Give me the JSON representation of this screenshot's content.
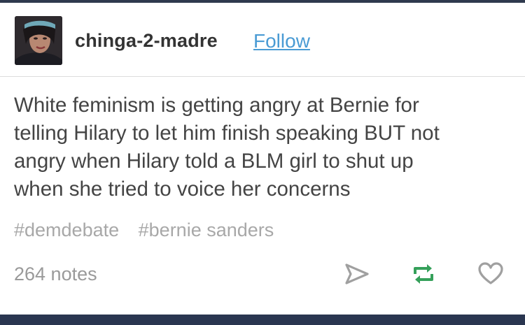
{
  "post": {
    "username": "chinga-2-madre",
    "follow_label": "Follow",
    "body_lines": [
      "White feminism is getting angry at Bernie for",
      "telling Hilary to let him finish speaking BUT not",
      "angry when Hilary told a BLM girl to shut up",
      "when she tried to voice her concerns"
    ],
    "tags": [
      "#demdebate",
      "#bernie sanders"
    ],
    "notes": "264 notes"
  },
  "icons": {
    "share": "paper-plane-icon",
    "reblog": "reblog-icon",
    "like": "heart-icon"
  },
  "colors": {
    "follow_link": "#4a9bd4",
    "reblog_green": "#35a05a",
    "icon_gray": "#a0a0a0",
    "frame_navy": "#2a3650"
  }
}
